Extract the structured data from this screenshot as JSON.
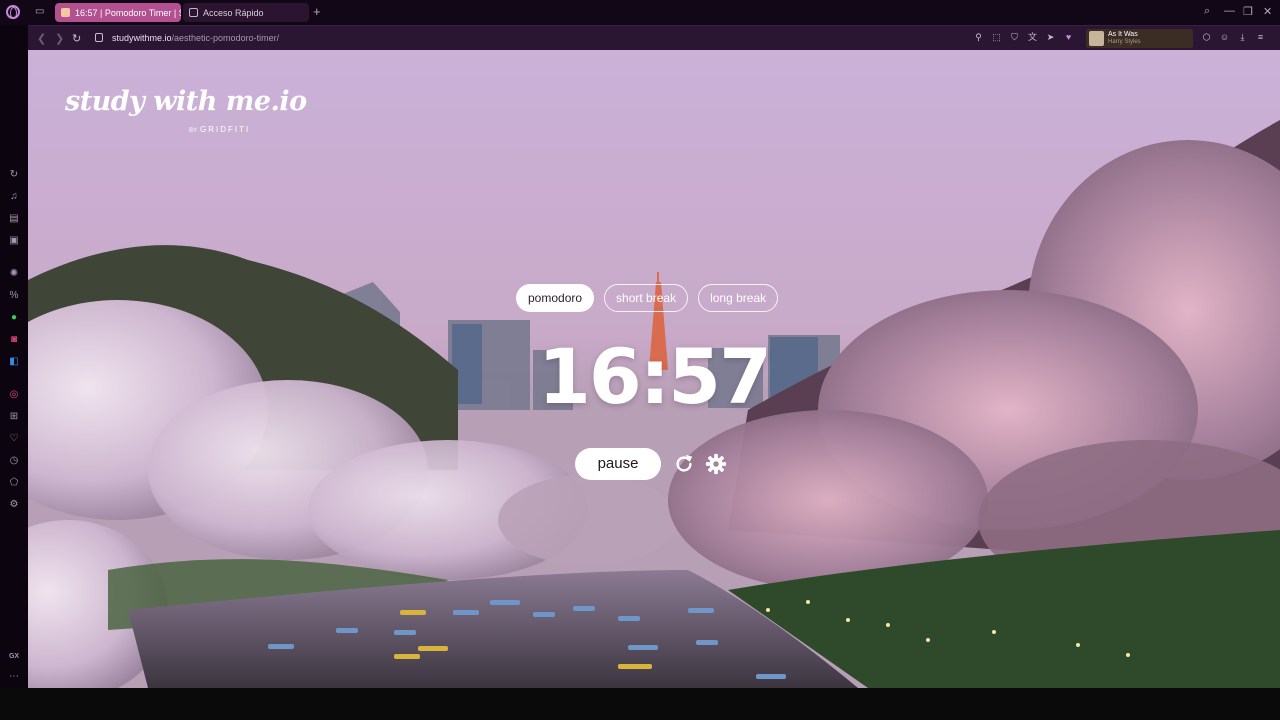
{
  "browser": {
    "tabs": [
      {
        "label": "16:57 | Pomodoro Timer | S",
        "active": true
      },
      {
        "label": "Acceso Rápido",
        "active": false
      }
    ],
    "address": {
      "host": "studywithme.io",
      "path": "/aesthetic-pomodoro-timer/"
    },
    "player": {
      "title": "As It Was",
      "artist": "Harry Styles"
    },
    "sidebar_bottom_label": "GX",
    "colors": {
      "accent": "#b3508f",
      "frame": "#110716"
    }
  },
  "page": {
    "brand": {
      "name": "study with me.io",
      "by_prefix": "BY",
      "by_name": "GRIDFITI"
    },
    "modes": [
      {
        "label": "pomodoro",
        "active": true
      },
      {
        "label": "short break",
        "active": false
      },
      {
        "label": "long break",
        "active": false
      }
    ],
    "timer": "16:57",
    "pause_label": "pause",
    "icons": {
      "reset": "reset-icon",
      "settings": "settings-icon"
    }
  }
}
